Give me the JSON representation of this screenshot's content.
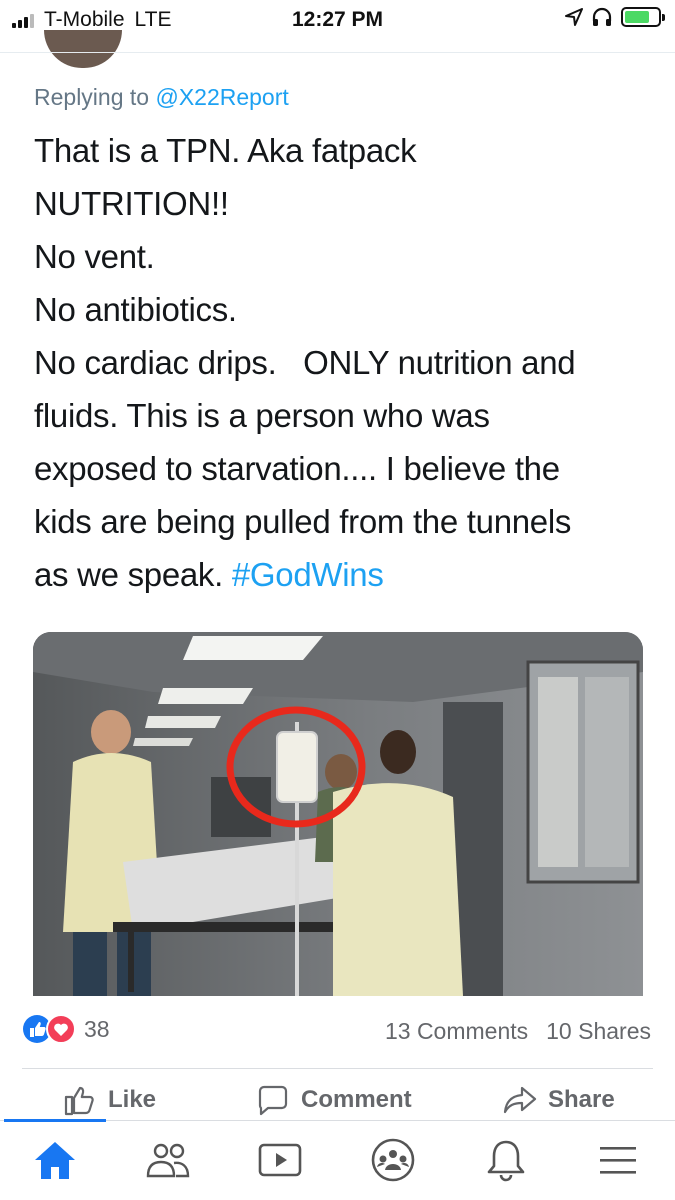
{
  "status_bar": {
    "carrier": "T-Mobile",
    "network": "LTE",
    "time": "12:27 PM"
  },
  "tweet": {
    "replying_prefix": "Replying to",
    "replying_handle": "@X22Report",
    "lines": [
      "That is a TPN. Aka fatpack",
      "NUTRITION!!",
      "No vent.",
      "No antibiotics.",
      "No cardiac drips.   ONLY nutrition and",
      "fluids. This is a person who was",
      "exposed to starvation.... I believe the",
      "kids are being pulled from the tunnels",
      "as we speak. "
    ],
    "hashtag": "#GodWins",
    "hashtag_color": "#1da1f2"
  },
  "post_stats": {
    "reaction_count": "38",
    "comments": "13 Comments",
    "shares": "10 Shares"
  },
  "actions": {
    "like": "Like",
    "comment": "Comment",
    "share": "Share"
  },
  "nav": {
    "items": [
      "home-icon",
      "friends-icon",
      "watch-icon",
      "groups-icon",
      "notifications-icon",
      "menu-icon"
    ],
    "active_color": "#1877f2"
  },
  "colors": {
    "like_blue": "#1877f2",
    "love_red": "#f33e58",
    "highlight_circle": "#e8291c"
  }
}
